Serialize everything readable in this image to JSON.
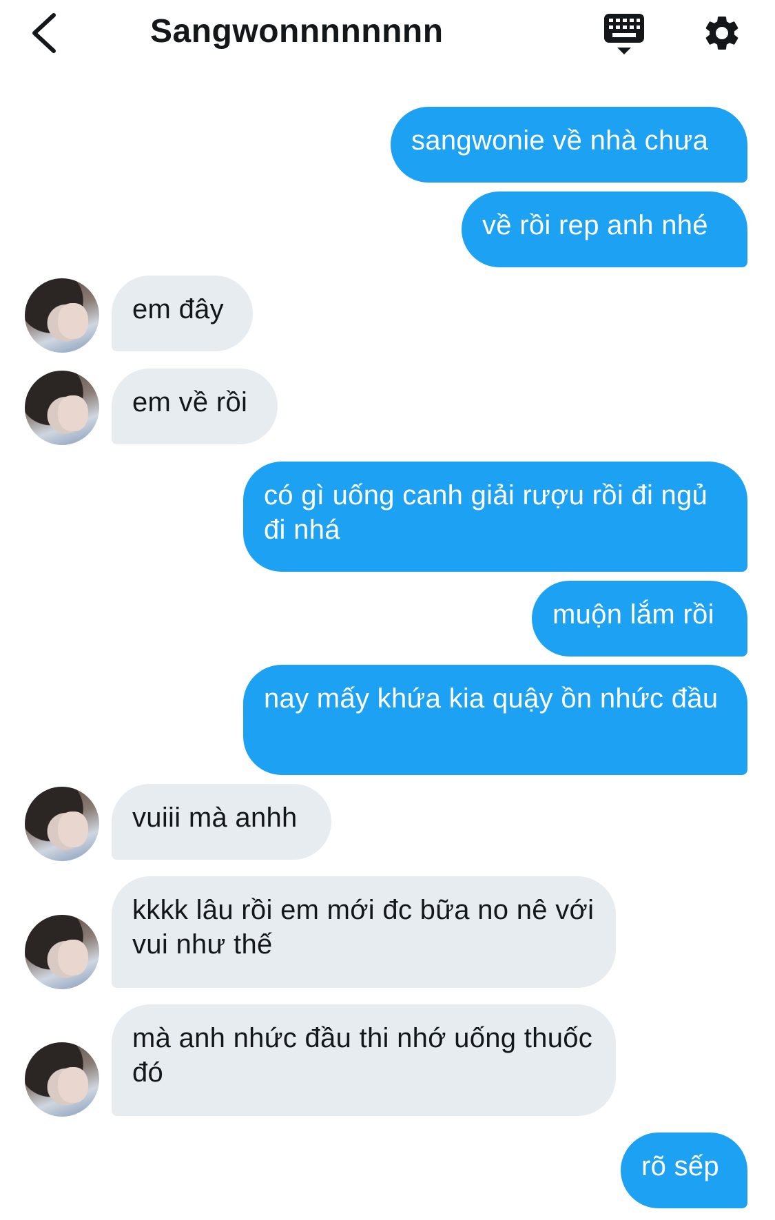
{
  "header": {
    "title": "Sangwonnnnnnnn"
  },
  "icons": {
    "back": "chevron-left-icon",
    "keyboard": "keyboard-icon",
    "settings": "gear-icon"
  },
  "colors": {
    "outgoing_bubble": "#1da1f2",
    "incoming_bubble": "#e6ecf0",
    "text_dark": "#14171a"
  },
  "messages": [
    {
      "from": "me",
      "text": "sangwonie về nhà chưa"
    },
    {
      "from": "me",
      "text": "về rồi rep anh nhé"
    },
    {
      "from": "them",
      "text": "em đây"
    },
    {
      "from": "them",
      "text": "em về rồi"
    },
    {
      "from": "me",
      "text": "có gì uống canh giải rượu rồi đi ngủ đi nhá"
    },
    {
      "from": "me",
      "text": "muộn lắm rồi"
    },
    {
      "from": "me",
      "text": "nay mấy khứa kia quậy ồn nhức đầu"
    },
    {
      "from": "them",
      "text": "vuiii mà anhh"
    },
    {
      "from": "them",
      "text": "kkkk lâu rồi em mới đc bữa no nê với vui như thế"
    },
    {
      "from": "them",
      "text": "mà anh nhức đầu thi nhớ uống thuốc đó"
    },
    {
      "from": "me",
      "text": "rõ sếp"
    }
  ]
}
